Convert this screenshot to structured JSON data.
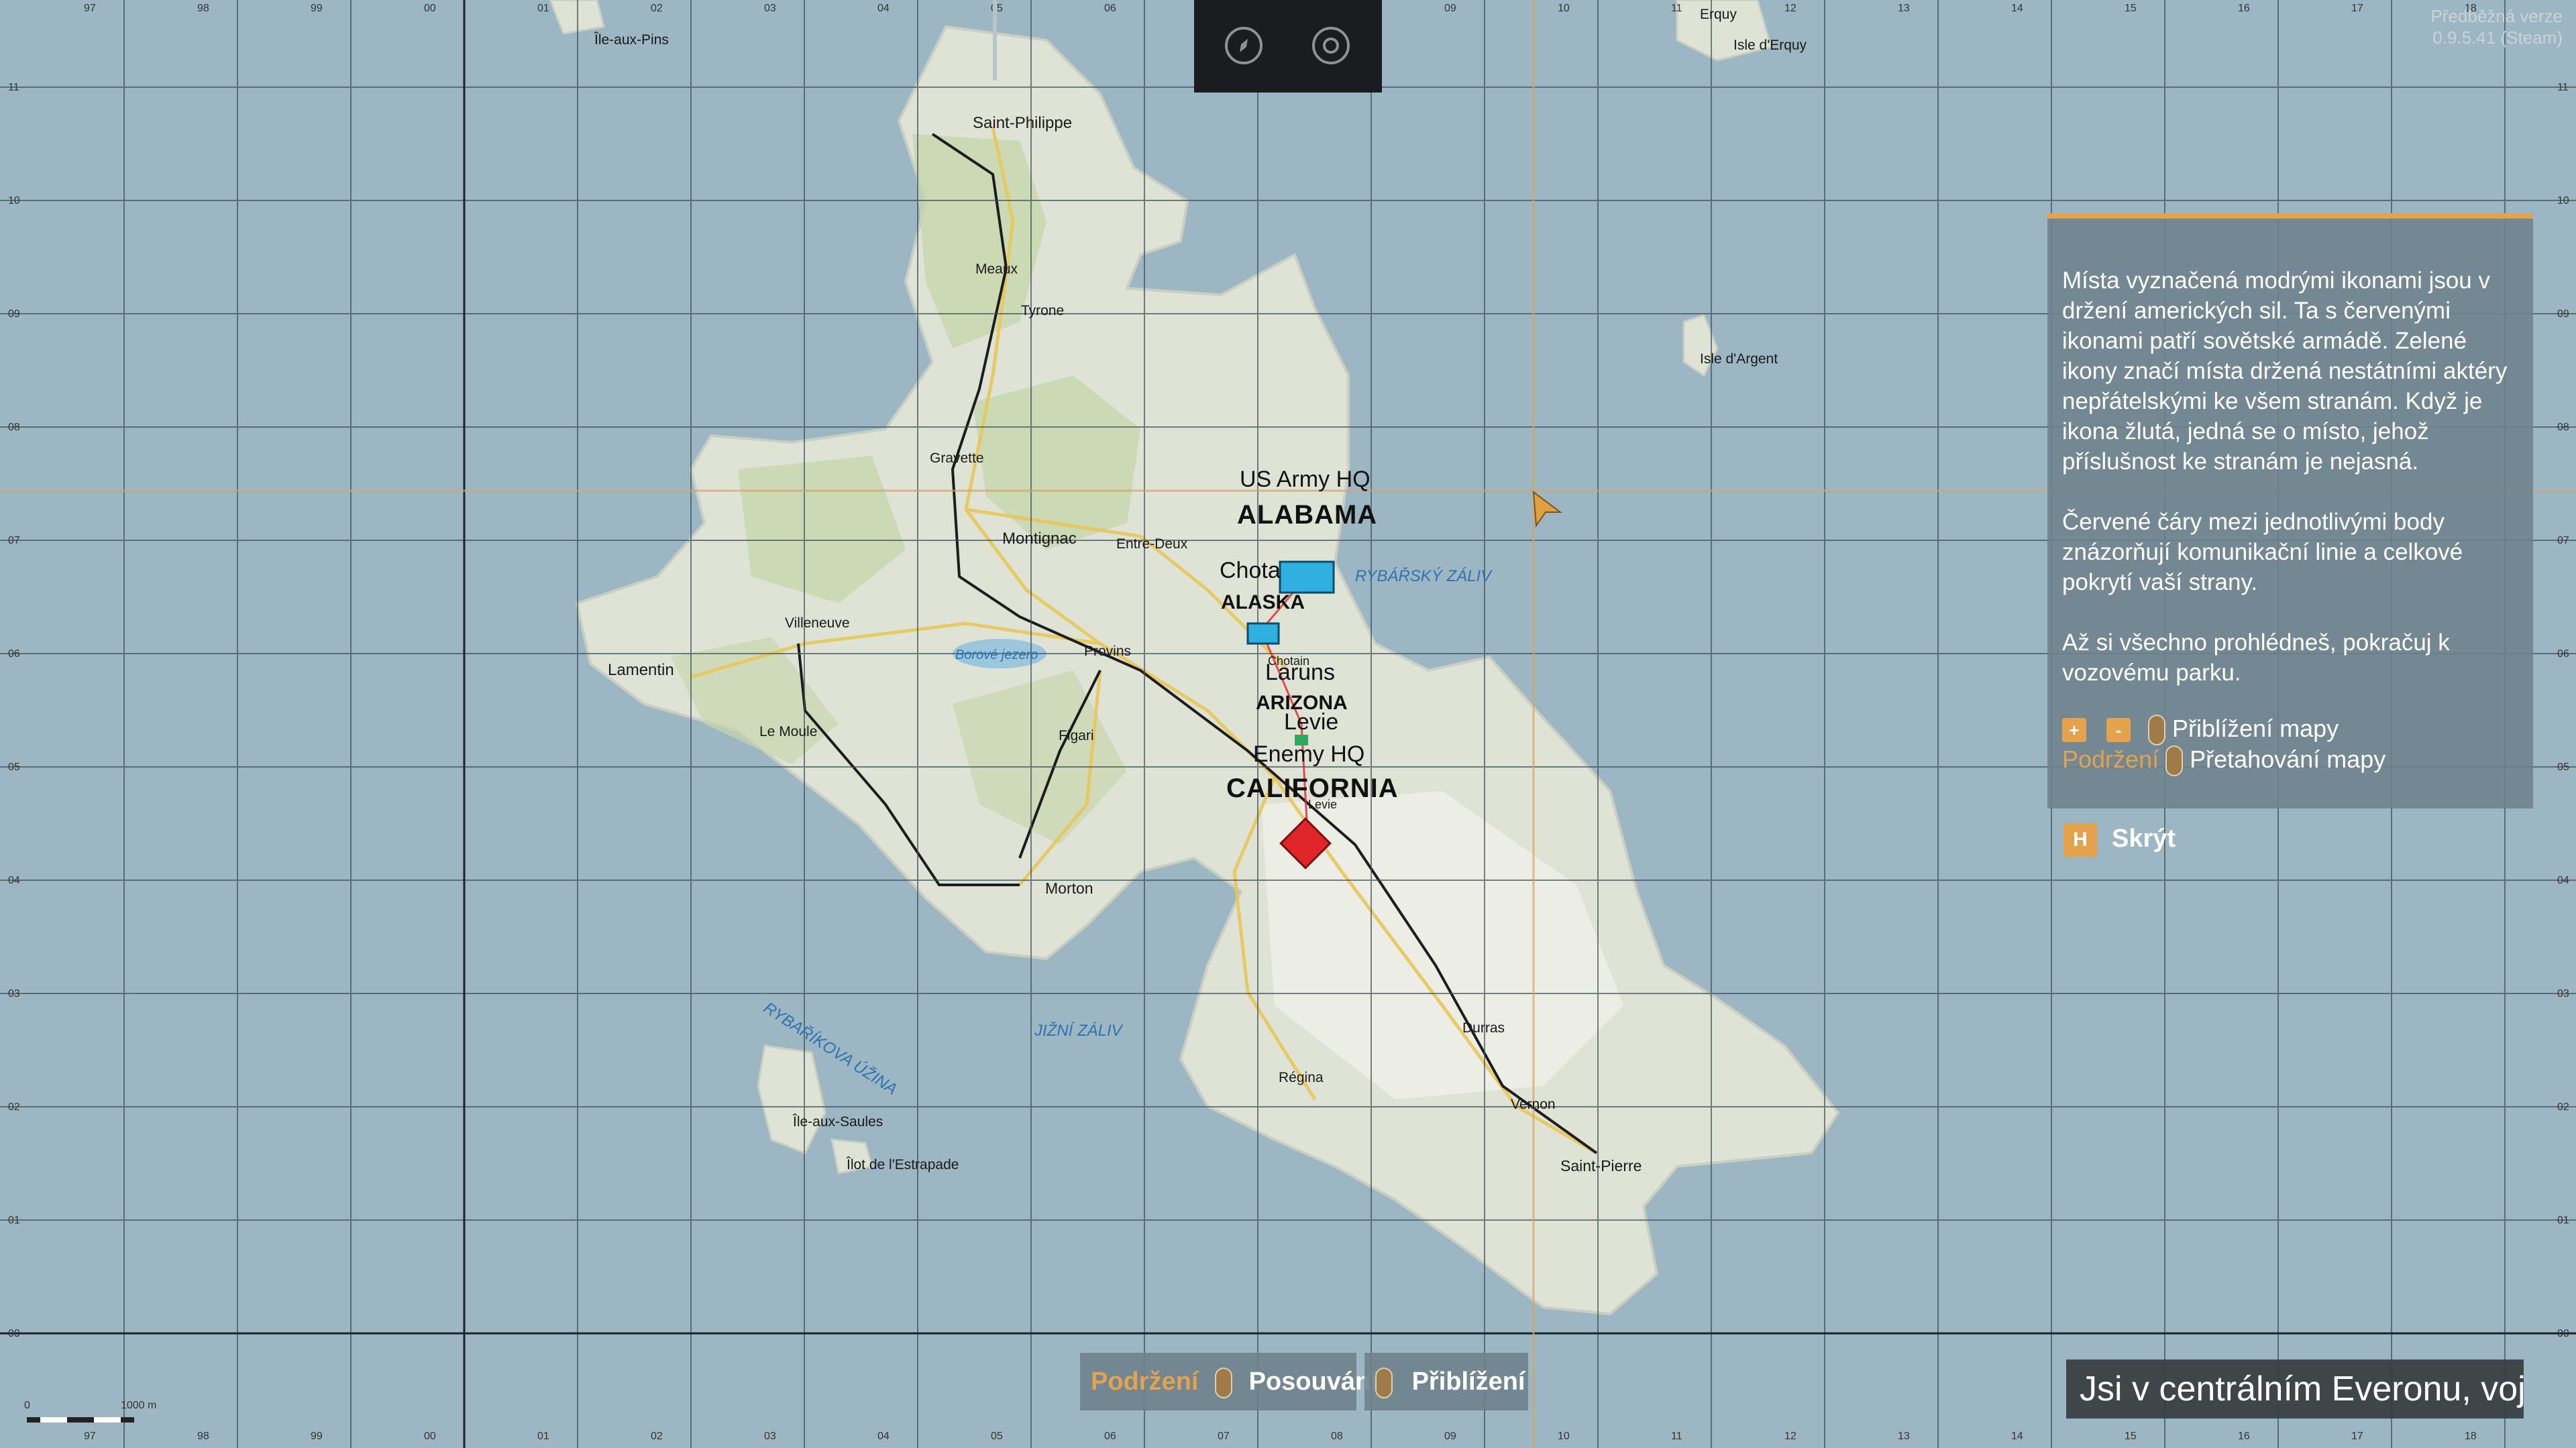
{
  "version": {
    "line1": "Předběžná verze",
    "line2": "0.9.5.41 (Steam)"
  },
  "grid": {
    "x_labels": [
      "97",
      "98",
      "99",
      "00",
      "01",
      "02",
      "03",
      "04",
      "05",
      "06",
      "07",
      "08",
      "09",
      "10",
      "11",
      "12",
      "13",
      "14",
      "15",
      "16",
      "17",
      "18"
    ],
    "y_labels": [
      "11",
      "10",
      "09",
      "08",
      "07",
      "06",
      "05",
      "04",
      "03",
      "02",
      "01",
      "00"
    ]
  },
  "towns": {
    "ile_aux_pins": "Île-aux-Pins",
    "erquy": "Erquy",
    "isle_derquy": "Isle d'Erquy",
    "saint_philippe": "Saint-Philippe",
    "meaux": "Meaux",
    "tyrone": "Tyrone",
    "isle_dargent": "Isle d'Argent",
    "gravette": "Gravette",
    "montignac": "Montignac",
    "entre_deux": "Entre-Deux",
    "villeneuve": "Villeneuve",
    "lamentin": "Lamentin",
    "provins": "Provins",
    "chotain_small": "Chotain",
    "le_moule": "Le Moule",
    "figari": "Figari",
    "levie_small": "Levie",
    "morton": "Morton",
    "durras": "Durras",
    "regina": "Régina",
    "vernon": "Vernon",
    "saint_pierre": "Saint-Pierre",
    "ile_aux_saules": "Île-aux-Saules",
    "ilot_estrapade": "Îlot de l'Estrapade"
  },
  "water": {
    "rybarsky_zaliv": "RYBÁŘSKÝ ZÁLIV",
    "borove_jezero": "Borové jezero",
    "rybarikova_uzina": "RYBAŘÍKOVA ÚŽINA",
    "jizni_zaliv": "JIŽNÍ ZÁLIV"
  },
  "objectives": {
    "us_hq": "US Army HQ",
    "alabama": "ALABAMA",
    "chotain": "Chota",
    "alaska": "ALASKA",
    "laruns": "Laruns",
    "arizona": "ARIZONA",
    "levie": "Levie",
    "enemy_hq": "Enemy HQ",
    "california": "CALIFORNIA"
  },
  "scale": {
    "zero": "0",
    "dist": "1000 m"
  },
  "info_panel": {
    "para1": "Místa vyznačená modrými ikonami jsou v držení amerických sil. Ta s červenými ikonami patří sovětské armádě. Zelené ikony značí místa držená nestátními aktéry nepřátelskými ke všem stranám. Když je ikona žlutá, jedná se o místo, jehož příslušnost ke stranám je nejasná.",
    "para2": "Červené čáry mezi jednotlivými body znázorňují komunikační linie a celkové pokrytí vaší strany.",
    "para3": "Až si všechno prohlédneš, pokračuj k vozovému parku.",
    "zoom_in_key": "+",
    "zoom_out_key": "-",
    "zoom_label": "Přiblížení mapy",
    "hold_label": "Podržení",
    "drag_label": "Přetahování mapy"
  },
  "hide": {
    "key": "H",
    "label": "Skrýt"
  },
  "bottom_hints": {
    "hold": "Podržení",
    "pan": "Posouvání",
    "zoom": "Přiblížení"
  },
  "status": "Jsi v centrálním Everonu, voj..",
  "colors": {
    "ocean": "#9cb7c3",
    "land": "#e4e6dc",
    "forest": "#bfd1a6",
    "friendly": "#2fb0e0",
    "enemy": "#e0262a",
    "accent": "#e3a24b"
  }
}
